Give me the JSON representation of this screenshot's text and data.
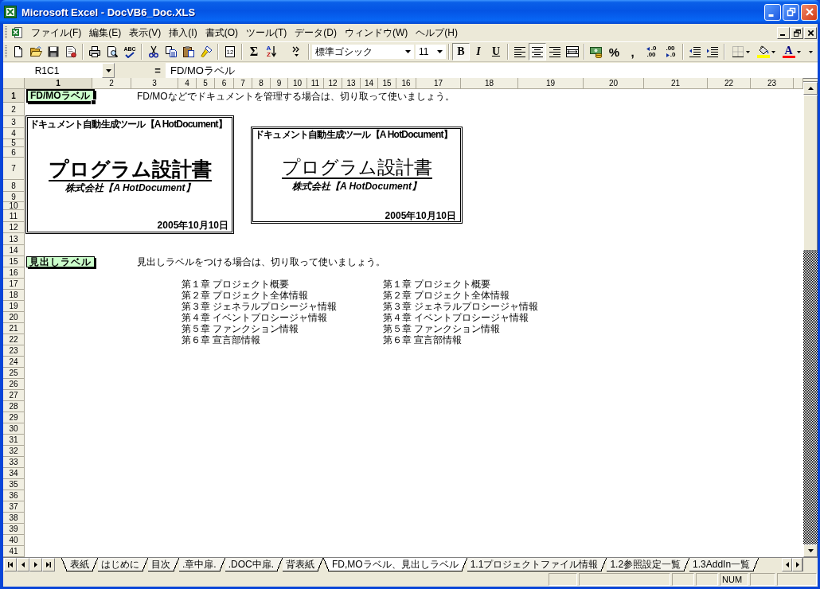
{
  "window": {
    "title": "Microsoft Excel - DocVB6_Doc.XLS"
  },
  "menu": [
    "ファイル(F)",
    "編集(E)",
    "表示(V)",
    "挿入(I)",
    "書式(O)",
    "ツール(T)",
    "データ(D)",
    "ウィンドウ(W)",
    "ヘルプ(H)"
  ],
  "toolbar": {
    "spelling": "ABC",
    "calendar": "12",
    "autosum": "Σ",
    "sort": [
      "A",
      "Z"
    ],
    "font": "標準ゴシック",
    "font_size": "11",
    "styles": [
      {
        "label": "B",
        "on": true
      },
      {
        "label": "I",
        "on": false
      },
      {
        "label": "U",
        "on": false
      }
    ],
    "alignment": [
      {
        "kind": "left",
        "selected": false
      },
      {
        "kind": "center",
        "selected": true
      },
      {
        "kind": "right",
        "selected": false
      }
    ],
    "number_formats": [
      "%",
      ","
    ],
    "decimals": [
      {
        "kind": "increase",
        "upper": ".0",
        "lower": ".00"
      },
      {
        "kind": "decrease",
        "upper": ".00",
        "lower": ".0"
      }
    ],
    "font_color": "A"
  },
  "formula_bar": {
    "name_box": "R1C1",
    "equals": "=",
    "content": "FD/MOラベル"
  },
  "sheet": {
    "columns": [
      {
        "label": "1",
        "selected": true
      },
      {
        "label": "2",
        "selected": false
      },
      {
        "label": "3",
        "selected": false
      },
      {
        "label": "4",
        "selected": false
      },
      {
        "label": "5",
        "selected": false
      },
      {
        "label": "6",
        "selected": false
      },
      {
        "label": "7",
        "selected": false
      },
      {
        "label": "8",
        "selected": false
      },
      {
        "label": "9",
        "selected": false
      },
      {
        "label": "10",
        "selected": false
      },
      {
        "label": "11",
        "selected": false
      },
      {
        "label": "12",
        "selected": false
      },
      {
        "label": "13",
        "selected": false
      },
      {
        "label": "14",
        "selected": false
      },
      {
        "label": "15",
        "selected": false
      },
      {
        "label": "16",
        "selected": false
      },
      {
        "label": "17",
        "selected": false
      },
      {
        "label": "18",
        "selected": false
      },
      {
        "label": "19",
        "selected": false
      },
      {
        "label": "20",
        "selected": false
      },
      {
        "label": "21",
        "selected": false
      },
      {
        "label": "22",
        "selected": false
      },
      {
        "label": "23",
        "selected": false
      }
    ],
    "rows": [
      {
        "label": "1",
        "selected": true
      },
      {
        "label": "2",
        "selected": false
      },
      {
        "label": "3",
        "selected": false
      },
      {
        "label": "4",
        "selected": false
      },
      {
        "label": "5",
        "selected": false
      },
      {
        "label": "6",
        "selected": false
      },
      {
        "label": "7",
        "selected": false
      },
      {
        "label": "8",
        "selected": false
      },
      {
        "label": "9",
        "selected": false
      },
      {
        "label": "10",
        "selected": false
      },
      {
        "label": "11",
        "selected": false
      },
      {
        "label": "12",
        "selected": false
      },
      {
        "label": "13",
        "selected": false
      },
      {
        "label": "14",
        "selected": false
      },
      {
        "label": "15",
        "selected": false
      },
      {
        "label": "16",
        "selected": false
      },
      {
        "label": "17",
        "selected": false
      },
      {
        "label": "18",
        "selected": false
      },
      {
        "label": "19",
        "selected": false
      },
      {
        "label": "20",
        "selected": false
      },
      {
        "label": "21",
        "selected": false
      },
      {
        "label": "22",
        "selected": false
      },
      {
        "label": "23",
        "selected": false
      },
      {
        "label": "24",
        "selected": false
      },
      {
        "label": "25",
        "selected": false
      },
      {
        "label": "26",
        "selected": false
      },
      {
        "label": "27",
        "selected": false
      },
      {
        "label": "28",
        "selected": false
      },
      {
        "label": "29",
        "selected": false
      },
      {
        "label": "30",
        "selected": false
      },
      {
        "label": "31",
        "selected": false
      },
      {
        "label": "32",
        "selected": false
      },
      {
        "label": "33",
        "selected": false
      },
      {
        "label": "34",
        "selected": false
      },
      {
        "label": "35",
        "selected": false
      },
      {
        "label": "36",
        "selected": false
      },
      {
        "label": "37",
        "selected": false
      },
      {
        "label": "38",
        "selected": false
      },
      {
        "label": "39",
        "selected": false
      },
      {
        "label": "40",
        "selected": false
      },
      {
        "label": "41",
        "selected": false
      }
    ],
    "fd_mo": {
      "label": {
        "text": "FD/MOラベル",
        "selected": true
      },
      "note": "FD/MOなどでドキュメントを管理する場合は、切り取って使いましょう。",
      "covers": [
        {
          "kind": "bold",
          "tool": "ドキュメント自動生成ツール【A HotDocument】",
          "title": "プログラム設計書",
          "company": "株式会社【A HotDocument】",
          "date": "2005年10月10日"
        },
        {
          "kind": "light",
          "tool": "ドキュメント自動生成ツール【A HotDocument】",
          "title": "プログラム設計書",
          "company": "株式会社【A HotDocument】",
          "date": "2005年10月10日"
        }
      ]
    },
    "headings": {
      "label": {
        "text": "見出しラベル",
        "selected": false
      },
      "note": "見出しラベルをつける場合は、切り取って使いましょう。",
      "lists": [
        [
          "第１章 プロジェクト概要",
          "第２章 プロジェクト全体情報",
          "第３章 ジェネラルプロシージャ情報",
          "第４章 イベントプロシージャ情報",
          "第５章 ファンクション情報",
          "第６章 宣言部情報"
        ],
        [
          "第１章 プロジェクト概要",
          "第２章 プロジェクト全体情報",
          "第３章 ジェネラルプロシージャ情報",
          "第４章 イベントプロシージャ情報",
          "第５章 ファンクション情報",
          "第６章 宣言部情報"
        ]
      ]
    }
  },
  "sheet_tabs": [
    {
      "label": "表紙",
      "selected": false
    },
    {
      "label": "はじめに",
      "selected": false
    },
    {
      "label": "目次",
      "selected": false
    },
    {
      "label": ".章中扉.",
      "selected": false
    },
    {
      "label": ".DOC中扉.",
      "selected": false
    },
    {
      "label": "背表紙",
      "selected": false
    },
    {
      "label": "FD,MOラベル、見出しラベル",
      "selected": true
    },
    {
      "label": "1.1プロジェクトファイル情報",
      "selected": false
    },
    {
      "label": "1.2参照設定一覧",
      "selected": false
    },
    {
      "label": "1.3AddIn一覧",
      "selected": false
    }
  ],
  "status_bar": {
    "num_lock": "NUM"
  }
}
